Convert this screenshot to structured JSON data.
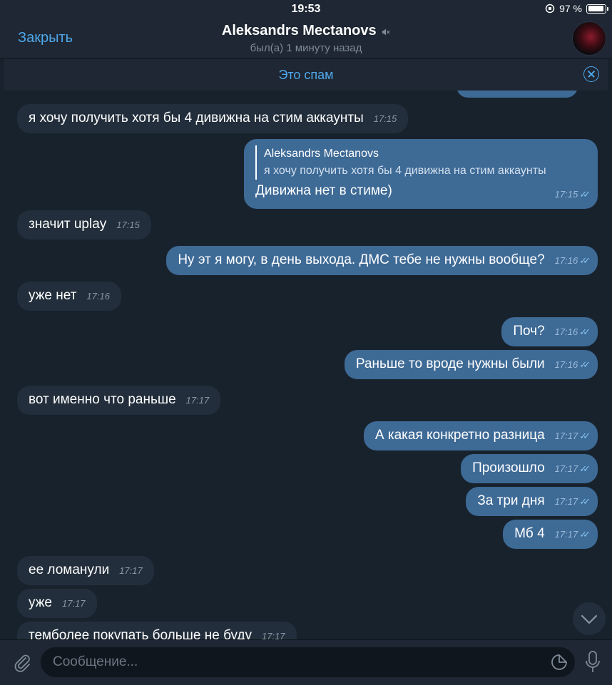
{
  "status_bar": {
    "time": "19:53",
    "battery": "97 %",
    "battery_level": 0.97
  },
  "header": {
    "close_label": "Закрыть",
    "contact_name": "Aleksandrs Mectanovs",
    "last_seen": "был(а) 1 минуту назад"
  },
  "spam_bar": {
    "label": "Это спам"
  },
  "messages": [
    {
      "dir": "in",
      "text": "я хочу получить хотя бы 4 дивижна на стим аккаунты",
      "time": "17:15"
    },
    {
      "dir": "out",
      "reply_name": "Aleksandrs Mectanovs",
      "reply_text": "я хочу получить хотя бы 4 дивижна на стим аккаунты",
      "text": "Дивижна нет в стиме)",
      "time": "17:15"
    },
    {
      "dir": "in",
      "text": "значит uplay",
      "time": "17:15"
    },
    {
      "dir": "out",
      "text": "Ну эт я могу, в день выхода. ДМС тебе не нужны вообще?",
      "time": "17:16"
    },
    {
      "dir": "in",
      "text": "уже нет",
      "time": "17:16"
    },
    {
      "dir": "out",
      "text": "Поч?",
      "time": "17:16"
    },
    {
      "dir": "out",
      "text": "Раньше то вроде нужны были",
      "time": "17:16"
    },
    {
      "dir": "in",
      "text": "вот именно что раньше",
      "time": "17:17"
    },
    {
      "dir": "out",
      "text": "А какая конкретно разница",
      "time": "17:17"
    },
    {
      "dir": "out",
      "text": "Произошло",
      "time": "17:17"
    },
    {
      "dir": "out",
      "text": "За три дня",
      "time": "17:17"
    },
    {
      "dir": "out",
      "text": "Мб 4",
      "time": "17:17"
    },
    {
      "dir": "in",
      "text": "ее ломанули",
      "time": "17:17"
    },
    {
      "dir": "in",
      "text": "уже",
      "time": "17:17"
    },
    {
      "dir": "in",
      "text": "темболее покупать больше не буду",
      "time": "17:17"
    }
  ],
  "composer": {
    "placeholder": "Сообщение..."
  },
  "colors": {
    "accent": "#4fa7ea",
    "background": "#18222d",
    "incoming_bubble": "#222e3b",
    "outgoing_bubble": "#3e6a96"
  },
  "icons": [
    "mute-icon",
    "close-circle-icon",
    "attach-icon",
    "sticker-icon",
    "microphone-icon",
    "chevron-down-icon",
    "read-checks-icon"
  ]
}
